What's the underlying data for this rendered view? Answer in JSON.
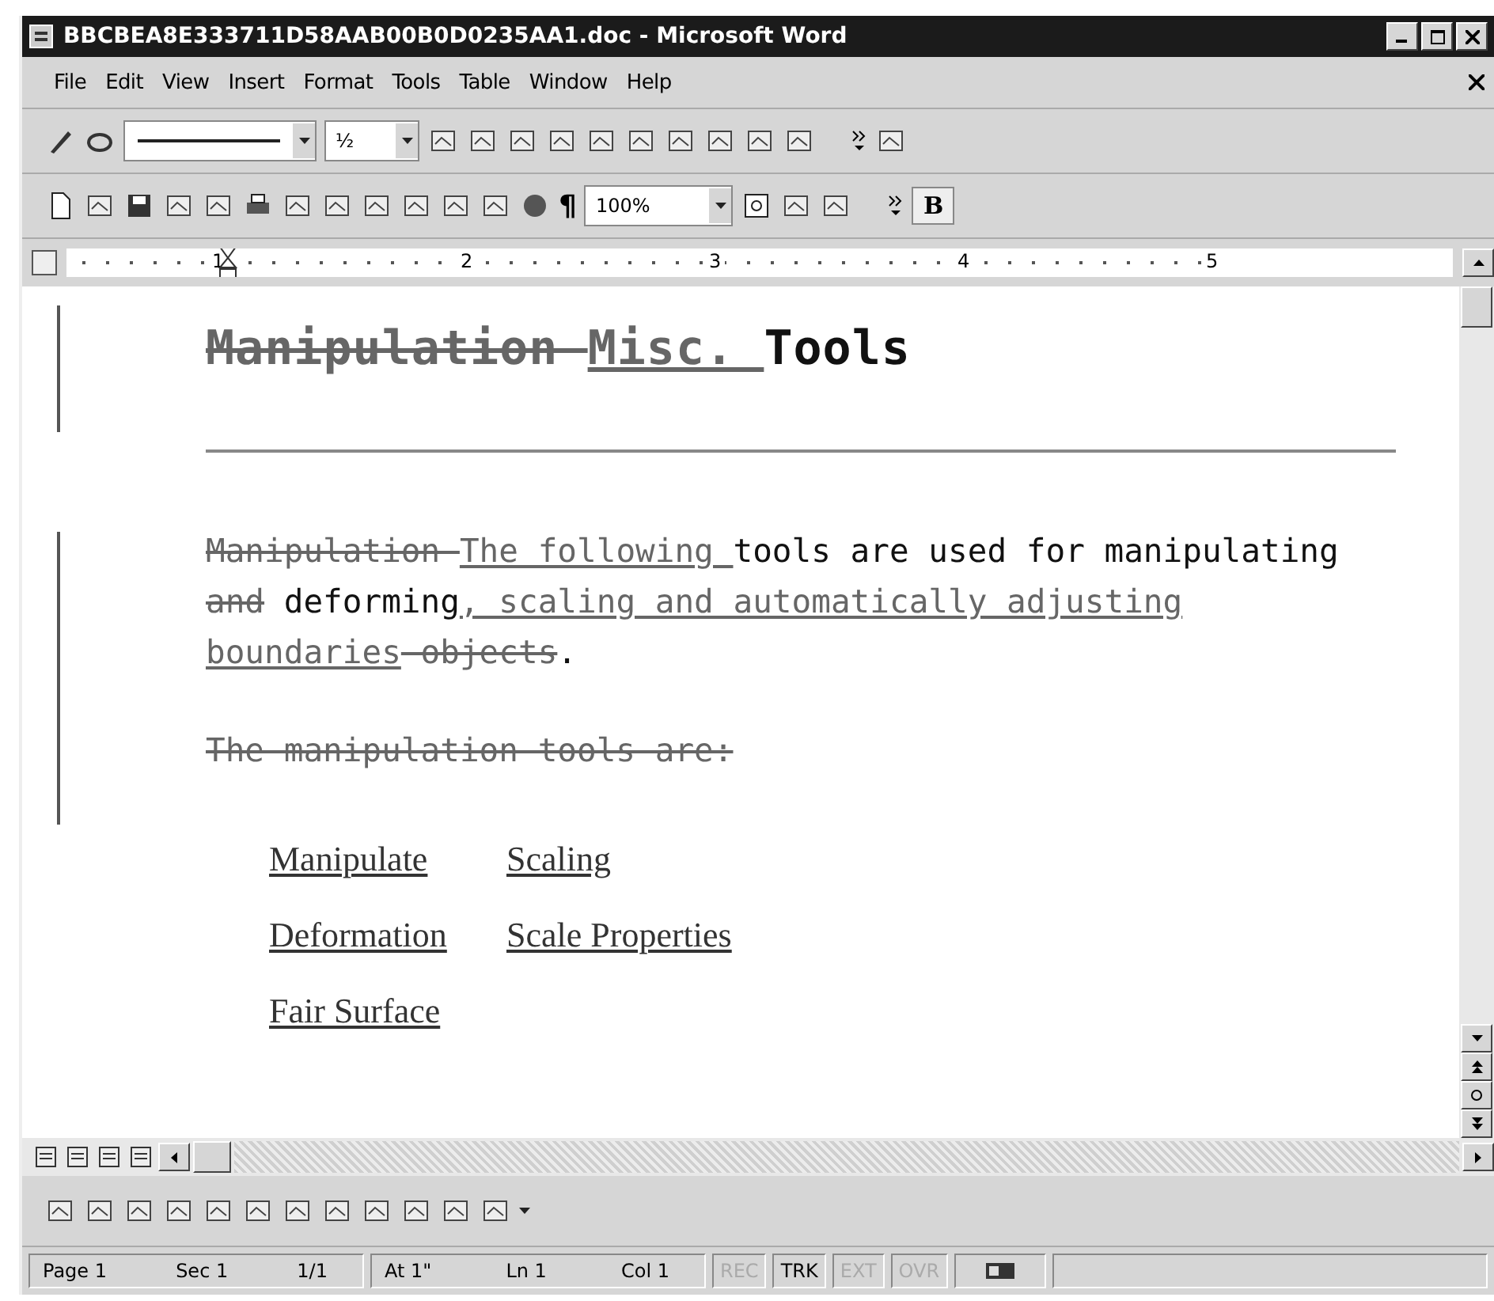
{
  "window": {
    "title": "BBCBEA8E333711D58AAB00B0D0235AA1.doc - Microsoft Word"
  },
  "menu": [
    "File",
    "Edit",
    "View",
    "Insert",
    "Format",
    "Tools",
    "Table",
    "Window",
    "Help"
  ],
  "tables_toolbar": {
    "line_weight": "½"
  },
  "standard_toolbar": {
    "formatting_mark": "¶",
    "zoom": "100%",
    "bold": "B"
  },
  "ruler": {
    "numbers": [
      "1",
      "2",
      "3",
      "4",
      "5"
    ]
  },
  "document": {
    "heading": [
      {
        "kind": "deleted",
        "text": "Manipulation "
      },
      {
        "kind": "inserted",
        "text": "Misc. "
      },
      {
        "kind": "plain",
        "text": "Tools"
      }
    ],
    "paragraphs": [
      [
        {
          "kind": "deleted",
          "text": "Manipulation "
        },
        {
          "kind": "inserted",
          "text": "The following "
        },
        {
          "kind": "plain",
          "text": "tools are used for manipulating"
        },
        {
          "kind": "deleted",
          "text": " and"
        },
        {
          "kind": "plain",
          "text": " deforming"
        },
        {
          "kind": "inserted",
          "text": ", scaling and automatically adjusting boundaries"
        },
        {
          "kind": "deleted",
          "text": " objects"
        },
        {
          "kind": "plain",
          "text": "."
        }
      ],
      [
        {
          "kind": "deleted",
          "text": "The manipulation tools are:"
        }
      ]
    ],
    "links": [
      [
        "Manipulate",
        "Scaling"
      ],
      [
        "Deformation",
        "Scale Properties"
      ],
      [
        "Fair Surface"
      ]
    ]
  },
  "status_bar": {
    "groups": [
      [
        "Page 1",
        "Sec 1",
        "1/1"
      ],
      [
        "At 1\"",
        "Ln 1",
        "Col 1"
      ]
    ],
    "modes": [
      {
        "label": "REC",
        "on": false
      },
      {
        "label": "TRK",
        "on": true
      },
      {
        "label": "EXT",
        "on": false
      },
      {
        "label": "OVR",
        "on": false
      }
    ]
  }
}
